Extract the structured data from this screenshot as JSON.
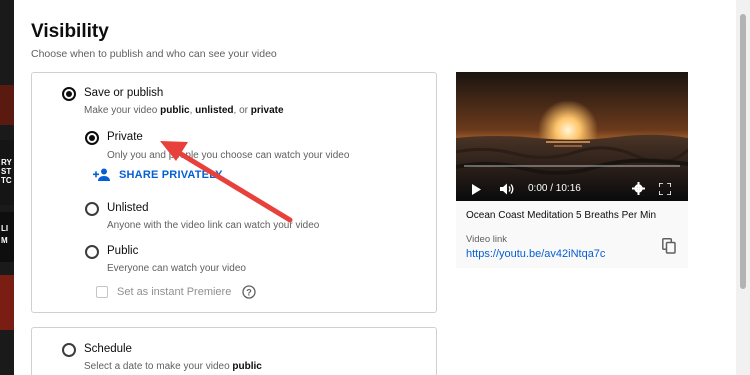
{
  "modal": {
    "title": "Visibility",
    "subtitle": "Choose when to publish and who can see your video"
  },
  "save_publish": {
    "label": "Save or publish",
    "desc_prefix": "Make your video ",
    "desc_public": "public",
    "desc_sep1": ", ",
    "desc_unlisted": "unlisted",
    "desc_sep2": ", or ",
    "desc_private": "private",
    "selected": true
  },
  "options": {
    "private": {
      "label": "Private",
      "desc": "Only you and people you choose can watch your video",
      "selected": true
    },
    "share": {
      "label": "SHARE PRIVATELY"
    },
    "unlisted": {
      "label": "Unlisted",
      "desc": "Anyone with the video link can watch your video",
      "selected": false
    },
    "public": {
      "label": "Public",
      "desc": "Everyone can watch your video",
      "selected": false
    },
    "premiere": {
      "label": "Set as instant Premiere",
      "checked": false
    }
  },
  "schedule": {
    "label": "Schedule",
    "desc_prefix": "Select a date to make your video ",
    "desc_public": "public",
    "selected": false
  },
  "preview": {
    "time": "0:00 / 10:16",
    "progress": 0,
    "video_title": "Ocean Coast Meditation 5 Breaths Per Min",
    "link_label": "Video link",
    "link_url": "https://youtu.be/av42iNtqa7c"
  },
  "background": {
    "snippets": [
      "RY",
      "ST",
      "TC",
      "LI",
      "M"
    ]
  },
  "colors": {
    "link": "#065fd4",
    "annotation_arrow": "#e8413c"
  }
}
